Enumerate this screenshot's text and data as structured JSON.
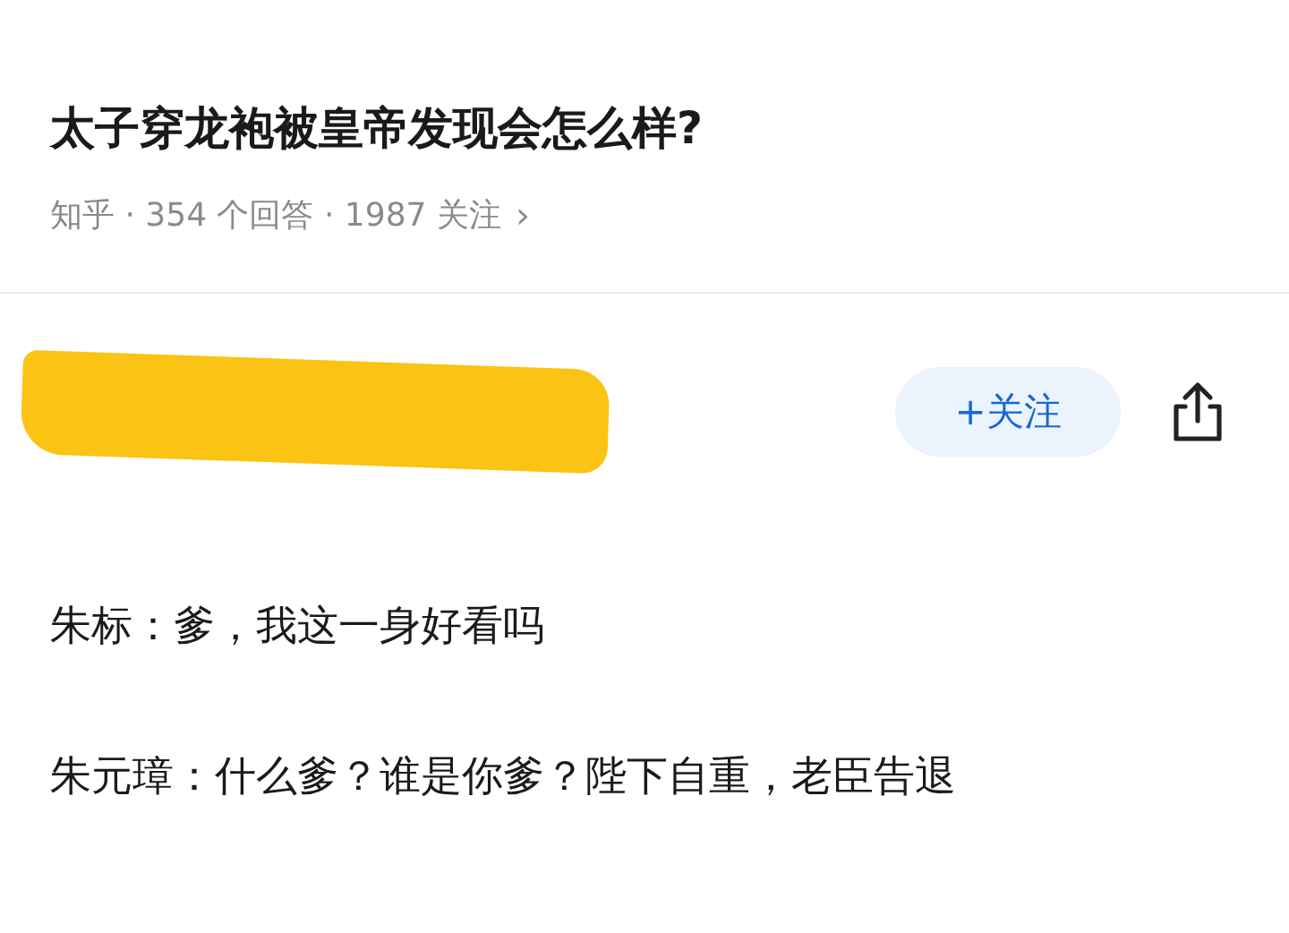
{
  "question": {
    "title": "太子穿龙袍被皇帝发现会怎么样?",
    "meta": "知乎 · 354 个回答 · 1987 关注",
    "chevron": "›"
  },
  "author": {
    "follow_button": "+关注"
  },
  "answer": {
    "paragraphs": [
      "朱标：爹，我这一身好看吗",
      "朱元璋：什么爹？谁是你爹？陛下自重，老臣告退"
    ]
  }
}
